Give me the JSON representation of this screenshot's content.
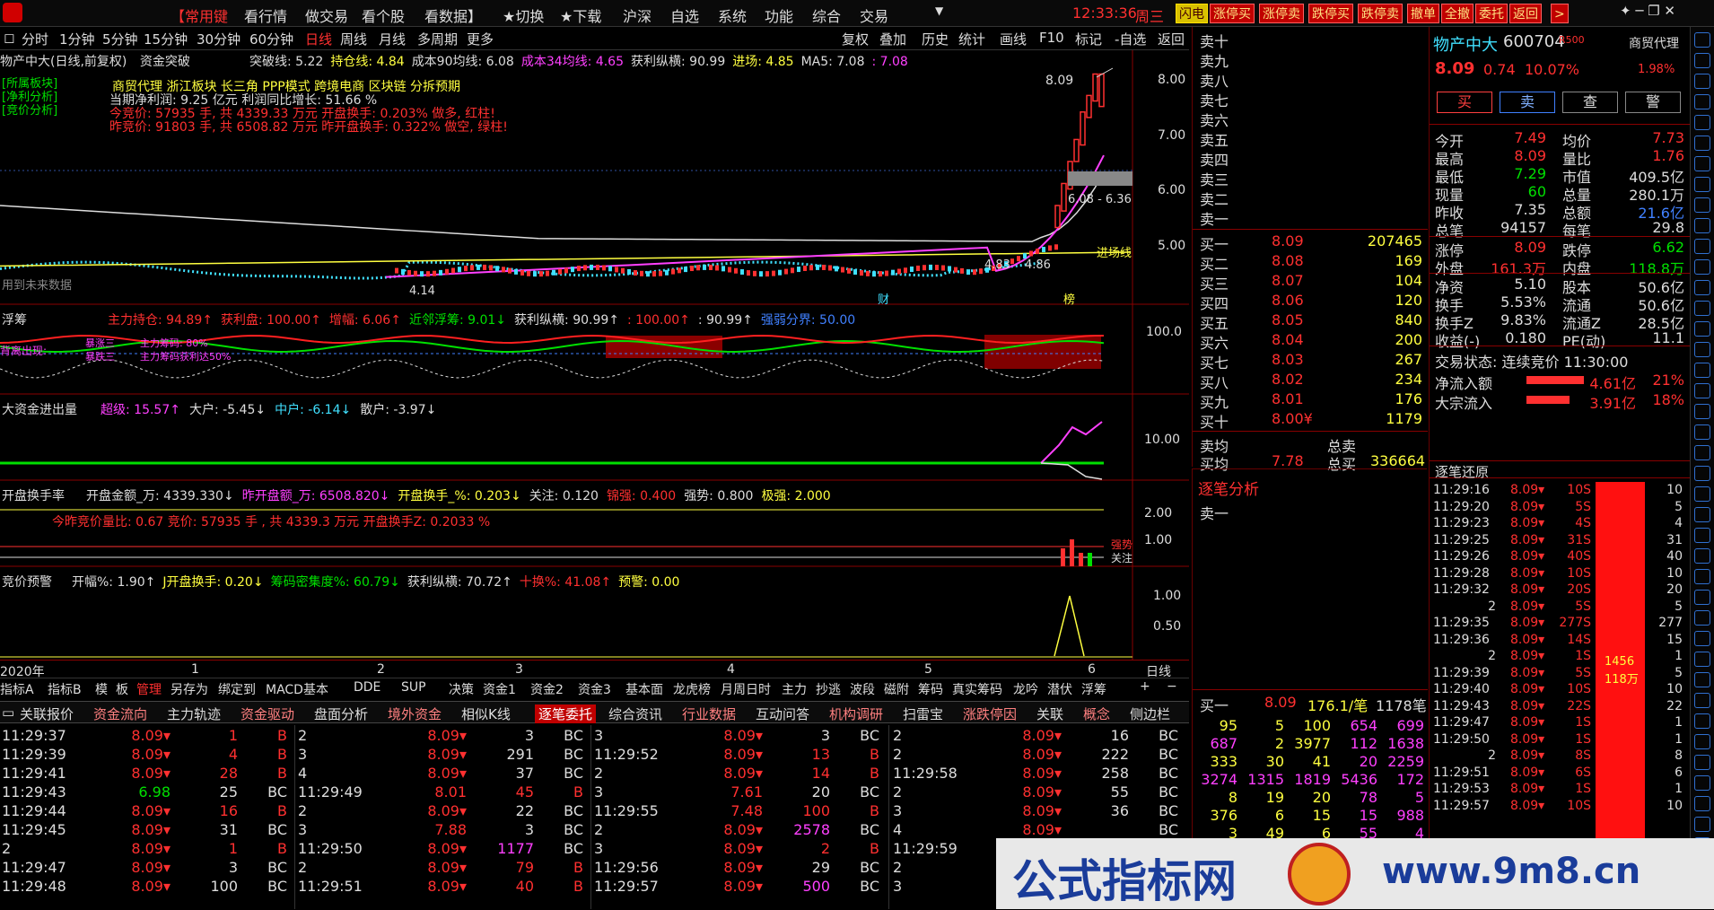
{
  "menu": {
    "logo": "logo",
    "items": [
      "【常用键",
      "看行情",
      "做交易",
      "看个股",
      "看数据】",
      "★切换",
      "★下载",
      "沪深",
      "自选",
      "系统",
      "功能",
      "综合",
      "交易"
    ],
    "time": "12:33:36",
    "weekday": "周三",
    "buttons": [
      "闪电",
      "涨停买",
      "涨停卖",
      "跌停买",
      "跌停卖",
      "撤单",
      "全撤",
      "委托",
      "返回"
    ]
  },
  "periods": {
    "left": [
      "分时",
      "1分钟",
      "5分钟",
      "15分钟",
      "30分钟",
      "60分钟",
      "日线",
      "周线",
      "月线",
      "多周期",
      "更多"
    ],
    "active": "日线",
    "right": [
      "复权",
      "叠加",
      "历史",
      "统计",
      "画线",
      "F10",
      "标记",
      "-自选",
      "返回"
    ]
  },
  "chart_title": {
    "name": "物产中大(日线,前复权)",
    "indicator": "资金突破",
    "items": [
      {
        "t": "突破线: 5.22",
        "c": "w"
      },
      {
        "t": "持仓线: 4.84",
        "c": "y"
      },
      {
        "t": "成本90均线: 6.08",
        "c": "w"
      },
      {
        "t": "成本34均线: 4.65",
        "c": "m"
      },
      {
        "t": "获利纵横: 90.99",
        "c": "w"
      },
      {
        "t": "进场: 4.85",
        "c": "y"
      },
      {
        "t": "MA5: 7.08",
        "c": "w"
      },
      {
        "t": ": 7.08",
        "c": "m"
      }
    ]
  },
  "info_block": {
    "labels": [
      "[所属板块]",
      "[净利分析]",
      "[竞价分析]"
    ],
    "sectors": "商贸代理    浙江板块    长三角  PPP模式  跨境电商  区块链  分拆预期",
    "profit": "当期净利润:  9.25 亿元      利润同比增长:  51.66 %",
    "auction1": "今竞价:  57935 手,   共 4339.33 万元      开盘换手:  0.203%      做多, 红柱!",
    "auction2": "昨竞价:  91803 手,   共 6508.82 万元      昨开盘换手:  0.322%      做空, 绿柱!"
  },
  "main_chart": {
    "y_ticks": [
      "8.00",
      "7.00",
      "6.00",
      "5.00"
    ],
    "high_label": "8.09",
    "range_label": "6.08 - 6.36",
    "low_label": "4.14",
    "markers": [
      "4.83",
      "4.86"
    ],
    "note": "用到未来数据",
    "entry": "进场线",
    "badges": [
      "财",
      "榜"
    ]
  },
  "panel2": {
    "name": "浮筹",
    "items": [
      {
        "t": "主力持仓: 94.89↑",
        "c": "r"
      },
      {
        "t": "获利盘: 100.00↑",
        "c": "r"
      },
      {
        "t": "增幅: 6.06↑",
        "c": "r"
      },
      {
        "t": "近邻浮筹: 9.01↓",
        "c": "g"
      },
      {
        "t": "获利纵横: 90.99↑",
        "c": "w"
      },
      {
        "t": ": 100.00↑",
        "c": "r"
      },
      {
        "t": ": 90.99↑",
        "c": "w"
      },
      {
        "t": "强弱分界: 50.00",
        "c": "b"
      }
    ],
    "y_tick": "100.0",
    "labels": [
      "背离出现:",
      "暴涨三",
      "主力筹码: 80%",
      "暴跌三",
      "主力筹码获利达50%"
    ]
  },
  "panel3": {
    "name": "大资金进出量",
    "items": [
      {
        "t": "超级: 15.57↑",
        "c": "m"
      },
      {
        "t": "大户: -5.45↓",
        "c": "w"
      },
      {
        "t": "中户: -6.14↓",
        "c": "c"
      },
      {
        "t": "散户: -3.97↓",
        "c": "w"
      }
    ],
    "y_tick": "10.00"
  },
  "panel4": {
    "name": "开盘换手率",
    "items": [
      {
        "t": "开盘金额_万: 4339.330↓",
        "c": "w"
      },
      {
        "t": "昨开盘额_万: 6508.820↓",
        "c": "m"
      },
      {
        "t": "开盘换手_%: 0.203↓",
        "c": "y"
      },
      {
        "t": "关注: 0.120",
        "c": "w"
      },
      {
        "t": "锦强: 0.400",
        "c": "r"
      },
      {
        "t": "强势: 0.800",
        "c": "w"
      },
      {
        "t": "极强: 2.000",
        "c": "y"
      }
    ],
    "line2": "今昨竞价量比:     0.67            竞价:  57935 手 , 共 4339.3 万元             开盘换手Z:  0.2033 %",
    "y_ticks": [
      "2.00",
      "1.00"
    ],
    "side": [
      "强势",
      "关注"
    ]
  },
  "panel5": {
    "name": "竞价预警",
    "items": [
      {
        "t": "开幅%: 1.90↑",
        "c": "w"
      },
      {
        "t": "J开盘换手: 0.20↓",
        "c": "y"
      },
      {
        "t": "筹码密集度%: 60.79↓",
        "c": "g"
      },
      {
        "t": "获利纵横: 70.72↑",
        "c": "w"
      },
      {
        "t": "十换%: 41.08↑",
        "c": "r"
      },
      {
        "t": "预警: 0.00",
        "c": "y"
      }
    ],
    "y_ticks": [
      "1.00",
      "0.50"
    ]
  },
  "x_axis": {
    "labels": [
      "2020年",
      "1",
      "2",
      "3",
      "4",
      "5",
      "6"
    ],
    "period": "日线"
  },
  "indicator_tabs": [
    "指标A",
    "指标B",
    "模",
    "板",
    "管理",
    "另存为",
    "绑定到",
    "MACD基本",
    "DDE",
    "SUP",
    "决策",
    "资金1",
    "资金2",
    "资金3",
    "基本面",
    "龙虎榜",
    "月周日时",
    "主力",
    "抄逃",
    "波段",
    "磁附",
    "筹码",
    "真实筹码",
    "龙吟",
    "潜伏",
    "浮筹"
  ],
  "bottom_tabs": [
    "关联报价",
    "资金流向",
    "主力轨迹",
    "资金驱动",
    "盘面分析",
    "境外资金",
    "相似K线",
    "逐笔委托",
    "综合资讯",
    "行业数据",
    "互动问答",
    "机构调研",
    "扫雷宝",
    "涨跌停因",
    "关联",
    "概念",
    "侧边栏"
  ],
  "bottom_active": "逐笔委托",
  "trades": [
    {
      "c1": [
        "11:29:37",
        "8.09▾",
        "1",
        "B"
      ],
      "c2": [
        "2",
        "8.09▾",
        "3",
        "BC"
      ],
      "c3": [
        "3",
        "8.09▾",
        "3",
        "BC"
      ],
      "c4": [
        "2",
        "8.09▾",
        "16",
        "BC"
      ]
    },
    {
      "c1": [
        "11:29:39",
        "8.09▾",
        "4",
        "B"
      ],
      "c2": [
        "3",
        "8.09▾",
        "291",
        "BC"
      ],
      "c3": [
        "11:29:52",
        "8.09▾",
        "13",
        "B"
      ],
      "c4": [
        "2",
        "8.09▾",
        "222",
        "BC"
      ]
    },
    {
      "c1": [
        "11:29:41",
        "8.09▾",
        "28",
        "B"
      ],
      "c2": [
        "4",
        "8.09▾",
        "37",
        "BC"
      ],
      "c3": [
        "2",
        "8.09▾",
        "14",
        "B"
      ],
      "c4": [
        "11:29:58",
        "8.09▾",
        "258",
        "BC"
      ]
    },
    {
      "c1": [
        "11:29:43",
        "6.98",
        "25",
        "BC"
      ],
      "c2": [
        "11:29:49",
        "8.01",
        "45",
        "B"
      ],
      "c3": [
        "3",
        "7.61",
        "20",
        "BC"
      ],
      "c4": [
        "2",
        "8.09▾",
        "55",
        "BC"
      ]
    },
    {
      "c1": [
        "11:29:44",
        "8.09▾",
        "16",
        "B"
      ],
      "c2": [
        "2",
        "8.09▾",
        "22",
        "BC"
      ],
      "c3": [
        "11:29:55",
        "7.48",
        "100",
        "B"
      ],
      "c4": [
        "3",
        "8.09▾",
        "36",
        "BC"
      ]
    },
    {
      "c1": [
        "11:29:45",
        "8.09▾",
        "31",
        "BC"
      ],
      "c2": [
        "3",
        "7.88",
        "3",
        "BC"
      ],
      "c3": [
        "2",
        "8.09▾",
        "2578",
        "BC"
      ],
      "c4": [
        "4",
        "8.09▾",
        "",
        "BC"
      ]
    },
    {
      "c1": [
        "2",
        "8.09▾",
        "1",
        "B"
      ],
      "c2": [
        "11:29:50",
        "8.09▾",
        "1177",
        "BC"
      ],
      "c3": [
        "3",
        "8.09▾",
        "2",
        "B"
      ],
      "c4": [
        "11:29:59",
        "",
        "",
        ""
      ]
    },
    {
      "c1": [
        "11:29:47",
        "8.09▾",
        "3",
        "BC"
      ],
      "c2": [
        "2",
        "8.09▾",
        "79",
        "B"
      ],
      "c3": [
        "11:29:56",
        "8.09▾",
        "29",
        "BC"
      ],
      "c4": [
        "2",
        "",
        "",
        ""
      ]
    },
    {
      "c1": [
        "11:29:48",
        "8.09▾",
        "100",
        "BC"
      ],
      "c2": [
        "11:29:51",
        "8.09▾",
        "40",
        "B"
      ],
      "c3": [
        "11:29:57",
        "8.09▾",
        "500",
        "BC"
      ],
      "c4": [
        "3",
        "",
        "",
        ""
      ]
    }
  ],
  "orderbook": {
    "sells": [
      "卖十",
      "卖九",
      "卖八",
      "卖七",
      "卖六",
      "卖五",
      "卖四",
      "卖三",
      "卖二",
      "卖一"
    ],
    "buys": [
      [
        "买一",
        "8.09",
        "207465"
      ],
      [
        "买二",
        "8.08",
        "169"
      ],
      [
        "买三",
        "8.07",
        "104"
      ],
      [
        "买四",
        "8.06",
        "120"
      ],
      [
        "买五",
        "8.05",
        "840"
      ],
      [
        "买六",
        "8.04",
        "200"
      ],
      [
        "买七",
        "8.03",
        "267"
      ],
      [
        "买八",
        "8.02",
        "234"
      ],
      [
        "买九",
        "8.01",
        "176"
      ],
      [
        "买十",
        "8.00¥",
        "1179"
      ]
    ],
    "sell_avg_label": "卖均",
    "total_sell_label": "总卖",
    "buy_avg": [
      "买均",
      "7.78",
      "总买",
      "336664"
    ]
  },
  "tick_analysis": {
    "title": "逐笔分析",
    "row": "卖一",
    "buy1": [
      "买一",
      "8.09",
      "176.1/笔",
      "1178笔"
    ],
    "queue": [
      [
        "95",
        "5",
        "100",
        "654",
        "699"
      ],
      [
        "687",
        "2",
        "3977",
        "112",
        "1638"
      ],
      [
        "333",
        "30",
        "41",
        "20",
        "2259"
      ],
      [
        "3274",
        "1315",
        "1819",
        "5436",
        "172"
      ],
      [
        "8",
        "19",
        "20",
        "78",
        "5"
      ],
      [
        "376",
        "6",
        "15",
        "15",
        "988"
      ],
      [
        "3",
        "49",
        "6",
        "55",
        "4"
      ]
    ]
  },
  "quote": {
    "name": "物产中大",
    "code": "600704",
    "tag": "R500",
    "sector": "商贸代理",
    "price": "8.09",
    "change": "0.74",
    "pct": "10.07%",
    "pct2": "1.98%",
    "actions": [
      "买",
      "卖",
      "查",
      "警"
    ],
    "stats": [
      [
        "今开",
        "7.49",
        "均价",
        "7.73"
      ],
      [
        "最高",
        "8.09",
        "量比",
        "1.76"
      ],
      [
        "最低",
        "7.29",
        "市值",
        "409.5亿"
      ],
      [
        "现量",
        "60",
        "总量",
        "280.1万"
      ],
      [
        "昨收",
        "7.35",
        "总额",
        "21.6亿"
      ],
      [
        "总笔",
        "94157",
        "每笔",
        "29.8"
      ]
    ],
    "stats2": [
      [
        "涨停",
        "8.09",
        "跌停",
        "6.62"
      ],
      [
        "外盘",
        "161.3万",
        "内盘",
        "118.8万"
      ]
    ],
    "stats3": [
      [
        "净资",
        "5.10",
        "股本",
        "50.6亿"
      ],
      [
        "换手",
        "5.53%",
        "流通",
        "50.6亿"
      ],
      [
        "换手Z",
        "9.83%",
        "流通Z",
        "28.5亿"
      ],
      [
        "收益(-)",
        "0.180",
        "PE(动)",
        "11.1"
      ]
    ],
    "status": "交易状态: 连续竞价 11:30:00",
    "flows": [
      [
        "净流入额",
        "4.61亿",
        "21%"
      ],
      [
        "大宗流入",
        "3.91亿",
        "18%"
      ]
    ]
  },
  "tick_restore": {
    "title": "逐笔还原",
    "rows": [
      [
        "11:29:16",
        "8.09▾",
        "10S",
        "10"
      ],
      [
        "11:29:20",
        "8.09▾",
        "5S",
        "5"
      ],
      [
        "11:29:23",
        "8.09▾",
        "4S",
        "4"
      ],
      [
        "11:29:25",
        "8.09▾",
        "31S",
        "31"
      ],
      [
        "11:29:26",
        "8.09▾",
        "40S",
        "40"
      ],
      [
        "11:29:28",
        "8.09▾",
        "10S",
        "10"
      ],
      [
        "11:29:32",
        "8.09▾",
        "20S",
        "20"
      ],
      [
        "2",
        "8.09▾",
        "5S",
        "5"
      ],
      [
        "11:29:35",
        "8.09▾",
        "277S",
        "277"
      ],
      [
        "11:29:36",
        "8.09▾",
        "14S",
        "15"
      ],
      [
        "2",
        "8.09▾",
        "1S",
        "1"
      ],
      [
        "11:29:39",
        "8.09▾",
        "5S",
        "5"
      ],
      [
        "11:29:40",
        "8.09▾",
        "10S",
        "10"
      ],
      [
        "11:29:43",
        "8.09▾",
        "22S",
        "22"
      ],
      [
        "11:29:47",
        "8.09▾",
        "1S",
        "1"
      ],
      [
        "11:29:50",
        "8.09▾",
        "1S",
        "1"
      ],
      [
        "2",
        "8.09▾",
        "8S",
        "8"
      ],
      [
        "11:29:51",
        "8.09▾",
        "6S",
        "6"
      ],
      [
        "11:29:53",
        "8.09▾",
        "1S",
        "1"
      ],
      [
        "11:29:57",
        "8.09▾",
        "10S",
        "10"
      ]
    ],
    "bar_label": "1456",
    "bar_label2": "118万"
  },
  "watermark": {
    "text": "公式指标网",
    "url": "www.9m8.cn"
  },
  "colors": {
    "red": "#ff3030",
    "green": "#00e000",
    "yellow": "#ffff40",
    "cyan": "#40e0ff",
    "magenta": "#ff40ff"
  }
}
